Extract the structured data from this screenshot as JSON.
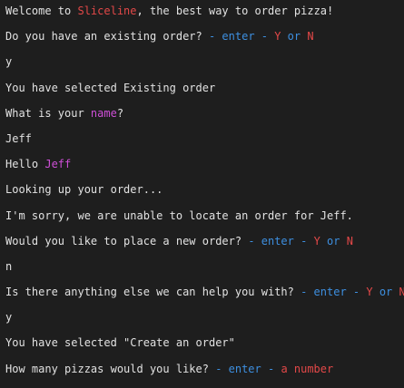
{
  "colors": {
    "background": "#1e1e1e",
    "text": "#e2e2e2",
    "red": "#e34848",
    "blue": "#3d8fe0",
    "magenta": "#cd4fd6"
  },
  "terminal": {
    "lines": [
      {
        "type": "output",
        "segments": [
          {
            "text": "Welcome to ",
            "color": "default"
          },
          {
            "text": "Sliceline",
            "color": "red"
          },
          {
            "text": ", the best way to order pizza!",
            "color": "default"
          }
        ]
      },
      {
        "type": "prompt",
        "segments": [
          {
            "text": "Do you have an existing order? ",
            "color": "default"
          },
          {
            "text": "- enter - ",
            "color": "blue"
          },
          {
            "text": "Y",
            "color": "red"
          },
          {
            "text": " or ",
            "color": "blue"
          },
          {
            "text": "N",
            "color": "red"
          }
        ]
      },
      {
        "type": "input",
        "segments": [
          {
            "text": "y",
            "color": "default"
          }
        ]
      },
      {
        "type": "output",
        "segments": [
          {
            "text": "You have selected Existing order",
            "color": "default"
          }
        ]
      },
      {
        "type": "prompt",
        "segments": [
          {
            "text": "What is your ",
            "color": "default"
          },
          {
            "text": "name",
            "color": "magenta"
          },
          {
            "text": "?",
            "color": "default"
          }
        ]
      },
      {
        "type": "input",
        "segments": [
          {
            "text": "Jeff",
            "color": "default"
          }
        ]
      },
      {
        "type": "output",
        "segments": [
          {
            "text": "Hello ",
            "color": "default"
          },
          {
            "text": "Jeff",
            "color": "magenta"
          }
        ]
      },
      {
        "type": "output",
        "segments": [
          {
            "text": "Looking up your order...",
            "color": "default"
          }
        ]
      },
      {
        "type": "output",
        "segments": [
          {
            "text": "I'm sorry, we are unable to locate an order for Jeff.",
            "color": "default"
          }
        ]
      },
      {
        "type": "prompt",
        "segments": [
          {
            "text": "Would you like to place a new order? ",
            "color": "default"
          },
          {
            "text": "- enter - ",
            "color": "blue"
          },
          {
            "text": "Y",
            "color": "red"
          },
          {
            "text": " or ",
            "color": "blue"
          },
          {
            "text": "N",
            "color": "red"
          }
        ]
      },
      {
        "type": "input",
        "segments": [
          {
            "text": "n",
            "color": "default"
          }
        ]
      },
      {
        "type": "prompt",
        "segments": [
          {
            "text": "Is there anything else we can help you with? ",
            "color": "default"
          },
          {
            "text": "- enter - ",
            "color": "blue"
          },
          {
            "text": "Y",
            "color": "red"
          },
          {
            "text": " or ",
            "color": "blue"
          },
          {
            "text": "N",
            "color": "red"
          }
        ]
      },
      {
        "type": "input",
        "segments": [
          {
            "text": "y",
            "color": "default"
          }
        ]
      },
      {
        "type": "output",
        "segments": [
          {
            "text": "You have selected \"Create an order\"",
            "color": "default"
          }
        ]
      },
      {
        "type": "prompt",
        "segments": [
          {
            "text": "How many pizzas would you like? ",
            "color": "default"
          },
          {
            "text": "- enter - ",
            "color": "blue"
          },
          {
            "text": "a number",
            "color": "red"
          }
        ]
      }
    ]
  }
}
